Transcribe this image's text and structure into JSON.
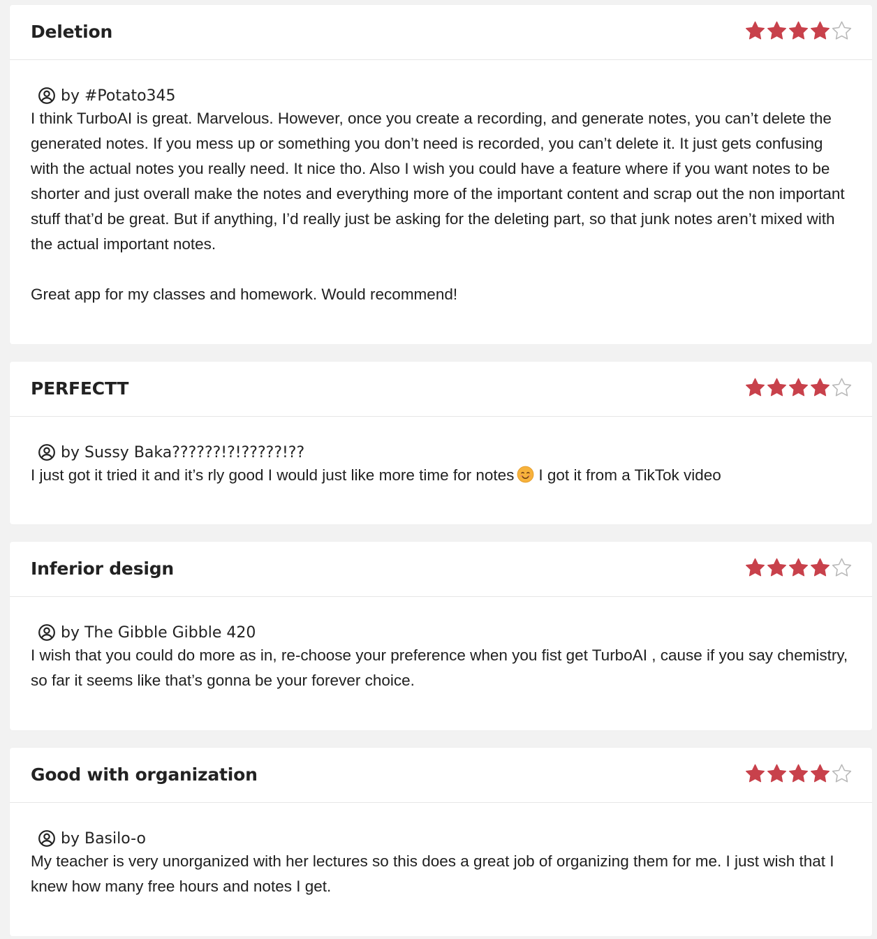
{
  "colors": {
    "star_filled": "#c8414b",
    "star_empty_stroke": "#b8b8b8",
    "background": "#f2f2f2",
    "card": "#ffffff"
  },
  "reviews": [
    {
      "title": "Deletion",
      "rating": 4,
      "rating_max": 5,
      "author": "by #Potato345",
      "author_icon": "user-circle-icon",
      "body": "I think TurboAI is great. Marvelous. However, once you create a recording, and generate notes, you can’t delete the generated notes. If you mess up or something you don’t need is recorded, you can’t delete it. It just gets confusing with the actual notes you really need. It nice tho. Also I wish you could have a feature where if you want notes to be shorter and just overall make the notes and everything more of the important content and scrap out the non important stuff that’d be great. But if anything, I’d really just be asking for the deleting part, so that junk notes aren’t mixed with the actual important notes.\n\nGreat app for my classes and homework. Would recommend!"
    },
    {
      "title": "PERFECTT",
      "rating": 4,
      "rating_max": 5,
      "author": "by Sussy Baka??????!?!?????!??",
      "author_icon": "user-circle-icon",
      "body_before_emoji": "I just got it tried it and it’s rly good I would just like more time for notes",
      "emoji": "smiling-face-emoji",
      "body_after_emoji": "I got it from a TikTok video"
    },
    {
      "title": "Inferior design",
      "rating": 4,
      "rating_max": 5,
      "author": "by The Gibble Gibble 420",
      "author_icon": "user-circle-icon",
      "body": "I wish that you could do more as in, re-choose your preference when you fist get TurboAI , cause if you say chemistry, so far it seems like that’s gonna be your forever choice."
    },
    {
      "title": "Good with organization",
      "rating": 4,
      "rating_max": 5,
      "author": "by Basilo-o",
      "author_icon": "user-circle-icon",
      "body": "My teacher is very unorganized with her lectures so this does a great job of organizing them for me. I just wish that I knew how many free hours and notes I get."
    }
  ]
}
